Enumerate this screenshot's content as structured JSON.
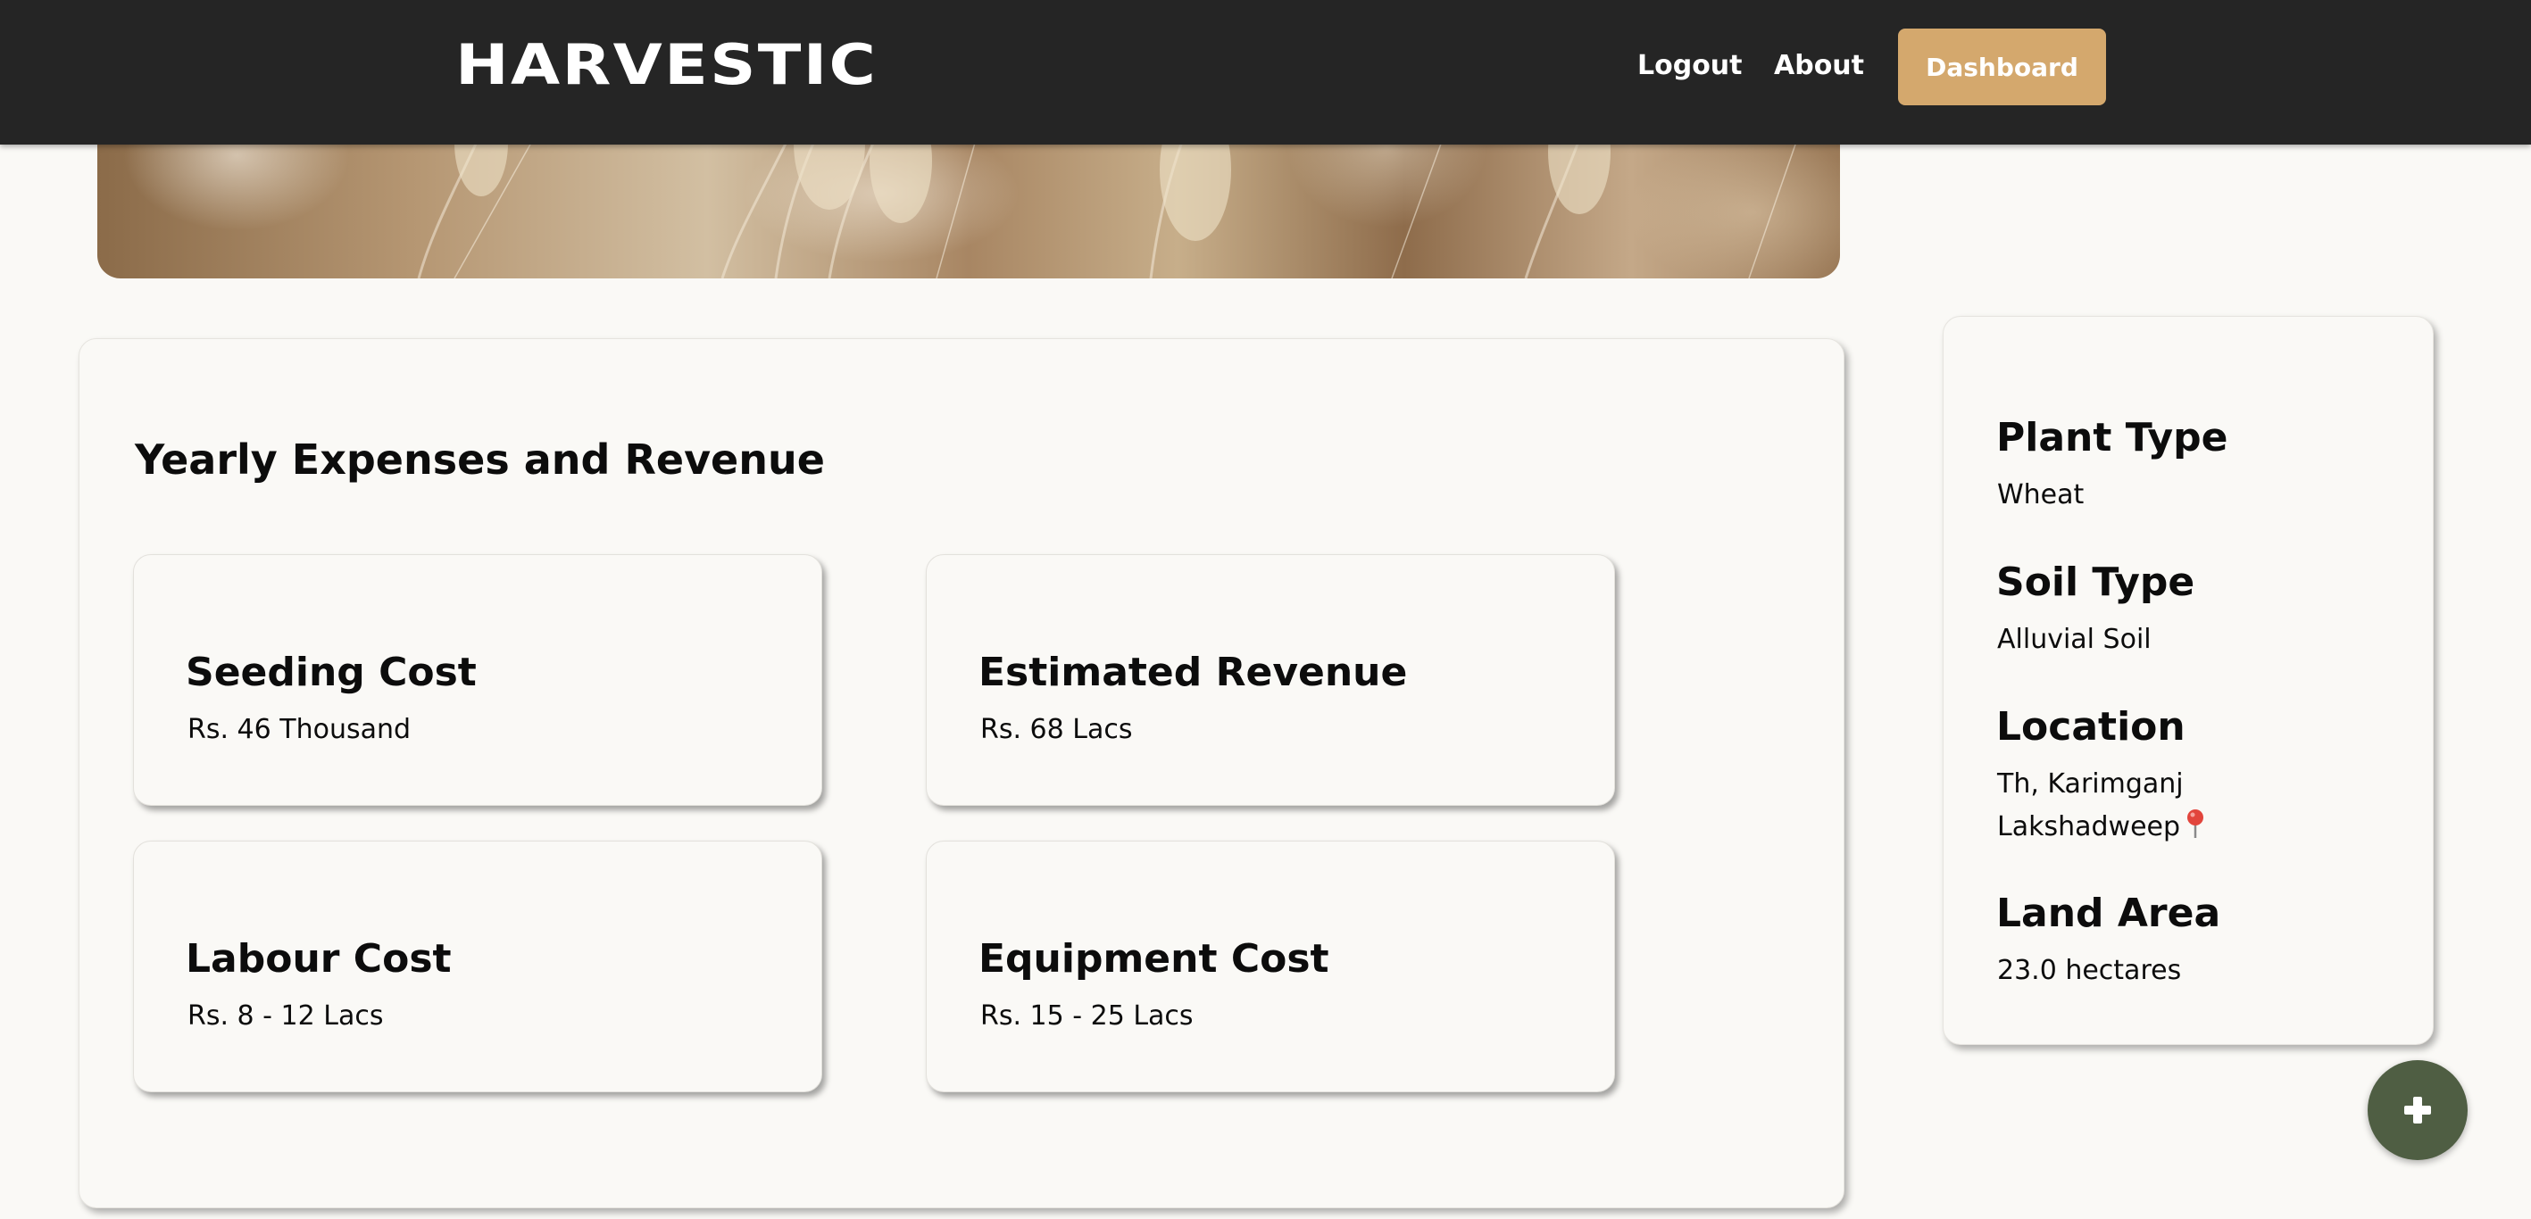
{
  "navbar": {
    "brand": "HARVESTIC",
    "logout_label": "Logout",
    "about_label": "About",
    "dashboard_label": "Dashboard"
  },
  "expenses": {
    "title": "Yearly Expenses and Revenue",
    "cards": [
      {
        "title": "Seeding Cost",
        "value": "Rs. 46 Thousand"
      },
      {
        "title": "Estimated Revenue",
        "value": "Rs. 68 Lacs"
      },
      {
        "title": "Labour Cost",
        "value": "Rs. 8 - 12 Lacs"
      },
      {
        "title": "Equipment Cost",
        "value": "Rs. 15 - 25 Lacs"
      }
    ]
  },
  "farm_info": {
    "plant_type_label": "Plant Type",
    "plant_type_value": "Wheat",
    "soil_type_label": "Soil Type",
    "soil_type_value": "Alluvial Soil",
    "location_label": "Location",
    "location_line1": "Th, Karimganj",
    "location_line2": "Lakshadweep",
    "location_icon": "map-pin-icon",
    "land_area_label": "Land Area",
    "land_area_value": "23.0 hectares"
  },
  "fab": {
    "icon": "plus-icon"
  },
  "colors": {
    "navbar_bg": "#252525",
    "accent": "#d4a86d",
    "page_bg": "#faf9f6",
    "fab_bg": "#4f5e43"
  }
}
